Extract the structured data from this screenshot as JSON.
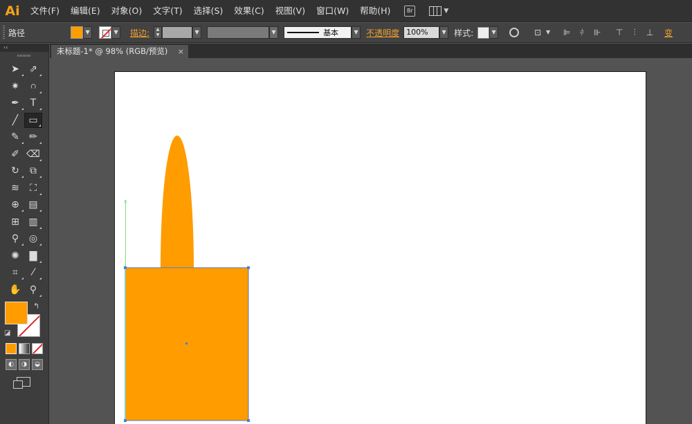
{
  "app": {
    "logo": "Ai",
    "bridge_label": "Br"
  },
  "menu": {
    "items": [
      "文件(F)",
      "编辑(E)",
      "对象(O)",
      "文字(T)",
      "选择(S)",
      "效果(C)",
      "视图(V)",
      "窗口(W)",
      "帮助(H)"
    ]
  },
  "control": {
    "selection_type": "路径",
    "fill_color": "#ff9c00",
    "stroke_label": "描边:",
    "stroke_profile": "基本",
    "opacity_label": "不透明度",
    "opacity_value": "100%",
    "style_label": "样式:",
    "transform_label": "变"
  },
  "toolbar": {
    "collapse_glyph": "‹‹",
    "swap_glyph": "↰",
    "fill_color": "#ff9c00",
    "tools": [
      [
        "selection-tool",
        "direct-selection-tool"
      ],
      [
        "magic-wand-tool",
        "lasso-tool"
      ],
      [
        "pen-tool",
        "type-tool"
      ],
      [
        "line-segment-tool",
        "rectangle-tool"
      ],
      [
        "paintbrush-tool",
        "pencil-tool"
      ],
      [
        "blob-brush-tool",
        "eraser-tool"
      ],
      [
        "rotate-tool",
        "scale-tool"
      ],
      [
        "width-tool",
        "free-transform-tool"
      ],
      [
        "shape-builder-tool",
        "perspective-grid-tool"
      ],
      [
        "mesh-tool",
        "gradient-tool"
      ],
      [
        "eyedropper-tool",
        "blend-tool"
      ],
      [
        "symbol-sprayer-tool",
        "column-graph-tool"
      ],
      [
        "artboard-tool",
        "slice-tool"
      ],
      [
        "hand-tool",
        "zoom-tool"
      ]
    ],
    "tool_glyphs": [
      [
        "➤",
        "⇗"
      ],
      [
        "✷",
        "ဂ"
      ],
      [
        "✒",
        "T"
      ],
      [
        "╱",
        "▭"
      ],
      [
        "✎",
        "✏"
      ],
      [
        "✐",
        "⌫"
      ],
      [
        "↻",
        "⧉"
      ],
      [
        "≋",
        "⛶"
      ],
      [
        "⊕",
        "▤"
      ],
      [
        "⊞",
        "▥"
      ],
      [
        "⚲",
        "◎"
      ],
      [
        "✺",
        "▇"
      ],
      [
        "⌗",
        "⁄"
      ],
      [
        "✋",
        "⚲"
      ]
    ]
  },
  "document": {
    "tab_title": "未标题-1* @ 98% (RGB/预览)",
    "close_glyph": "×"
  },
  "artwork": {
    "shape_color": "#ff9c00",
    "selection_color": "#4d7bd6",
    "guide_color": "#7be07b"
  }
}
